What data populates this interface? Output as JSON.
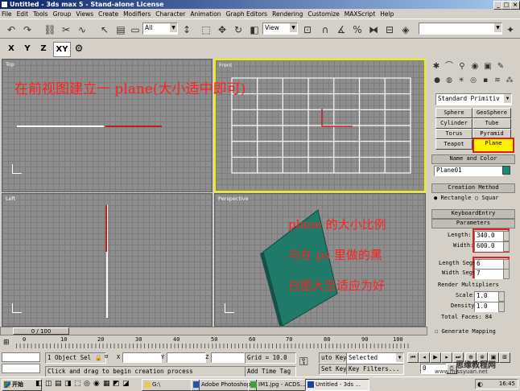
{
  "window": {
    "title": "Untitled - 3ds max 5 - Stand-alone License",
    "min": "_",
    "max": "□",
    "close": "×"
  },
  "menu": [
    "File",
    "Edit",
    "Tools",
    "Group",
    "Views",
    "Create",
    "Modifiers",
    "Character",
    "Animation",
    "Graph Editors",
    "Rendering",
    "Customize",
    "MAXScript",
    "Help"
  ],
  "toolbar": {
    "selection_filter": "All",
    "ref_coord": "View",
    "axis_labels": [
      "X",
      "Y",
      "Z",
      "XY"
    ]
  },
  "viewports": {
    "top": "Top",
    "front": "Front",
    "left": "Left",
    "perspective": "Perspective"
  },
  "command_panel": {
    "category": "Standard Primitiv",
    "object_types": [
      "Sphere",
      "GeoSphere",
      "Cylinder",
      "Tube",
      "Torus",
      "Pyramid",
      "Teapot",
      "Plane"
    ],
    "name_color_header": "Name and Color",
    "object_name": "Plane01",
    "object_color": "#1a8a78",
    "creation_method_header": "Creation Method",
    "creation_rect": "Rectangle",
    "creation_square": "Squar",
    "keyboard_entry_header": "KeyboardEntry",
    "parameters_header": "Parameters",
    "length_label": "Length:",
    "length_value": "340.0",
    "width_label": "Width:",
    "width_value": "600.0",
    "length_segs_label": "Length Segs:",
    "length_segs_value": "6",
    "width_segs_label": "Width Segs:",
    "width_segs_value": "7",
    "render_mult_label": "Render Multipliers",
    "scale_label": "Scale:",
    "scale_value": "1.0",
    "density_label": "Density:",
    "density_value": "1.0",
    "total_faces": "Total Faces: 84",
    "gen_mapping": "Generate Mapping"
  },
  "annotations": {
    "front_note": "在前视图建立一 plane(大小适中即可)",
    "line1": "plane 的大小比例",
    "line2": "与在 ps 里做的黑",
    "line3": "白图大至适应为好"
  },
  "timeline": {
    "slider_label": "0 / 100",
    "ticks": [
      "0",
      "10",
      "20",
      "30",
      "40",
      "50",
      "60",
      "70",
      "80",
      "90",
      "100"
    ]
  },
  "status": {
    "selection": "1 Object Sel",
    "x_label": "X",
    "y_label": "Y",
    "z_label": "Z",
    "grid": "Grid = 10.0",
    "prompt": "Click and drag to begin creation process",
    "add_time_tag": "Add Time Tag",
    "auto_key": "uto Key",
    "selected": "Selected",
    "set_key": "Set Key",
    "key_filters": "Key Filters...",
    "frame": "0"
  },
  "taskbar": {
    "start": "开始",
    "tasks": [
      "G:\\",
      "Adobe Photoshop",
      "IM1.jpg - ACDS...",
      "Untitled - 3ds ..."
    ],
    "time": "16:45",
    "watermark": "思缘教程网",
    "watermark_url": "www.missyuan.net"
  }
}
